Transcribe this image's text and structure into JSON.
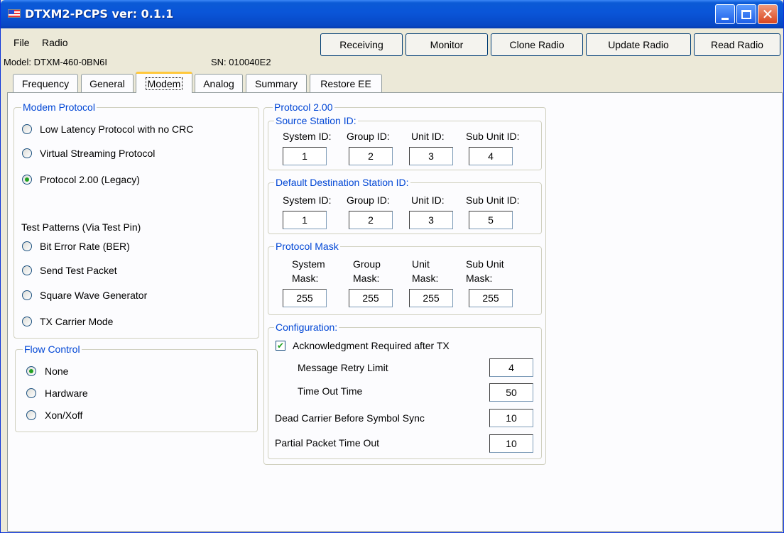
{
  "window": {
    "title": "DTXM2-PCPS ver: 0.1.1",
    "controls": {
      "minimize_icon": "minimize-icon",
      "maximize_icon": "maximize-icon",
      "close_icon": "close-icon"
    },
    "close_glyph": "✕"
  },
  "menu": {
    "file": "File",
    "radio": "Radio"
  },
  "toolbar": {
    "receiving": "Receiving",
    "monitor": "Monitor",
    "clone_radio": "Clone Radio",
    "update_radio": "Update Radio",
    "read_radio": "Read Radio"
  },
  "device": {
    "model": "Model: DTXM-460-0BN6I",
    "sn": "SN: 010040E2"
  },
  "tabs": [
    "Frequency",
    "General",
    "Modem",
    "Analog",
    "Summary",
    "Restore EE"
  ],
  "active_tab": "Modem",
  "modem_protocol": {
    "legend": "Modem Protocol",
    "options": [
      "Low Latency Protocol with no CRC",
      "Virtual Streaming Protocol",
      "Protocol 2.00 (Legacy)"
    ],
    "selected": "Protocol 2.00 (Legacy)",
    "test_patterns_label": "Test Patterns (Via Test Pin)",
    "test_patterns": [
      "Bit Error Rate (BER)",
      "Send Test Packet",
      "Square Wave Generator",
      "TX Carrier Mode"
    ]
  },
  "flow_control": {
    "legend": "Flow Control",
    "options": [
      "None",
      "Hardware",
      "Xon/Xoff"
    ],
    "selected": "None"
  },
  "protocol2": {
    "legend": "Protocol 2.00",
    "source_station": {
      "legend": "Source Station ID:",
      "labels": [
        "System ID:",
        "Group ID:",
        "Unit ID:",
        "Sub Unit ID:"
      ],
      "values": [
        "1",
        "2",
        "3",
        "4"
      ]
    },
    "default_destination": {
      "legend": "Default Destination Station ID:",
      "labels": [
        "System ID:",
        "Group ID:",
        "Unit ID:",
        "Sub Unit ID:"
      ],
      "values": [
        "1",
        "2",
        "3",
        "5"
      ]
    },
    "protocol_mask": {
      "legend": "Protocol Mask",
      "labels_line1": [
        "System",
        "Group",
        "Unit",
        "Sub Unit"
      ],
      "labels_line2": [
        "Mask:",
        "Mask:",
        "Mask:",
        "Mask:"
      ],
      "values": [
        "255",
        "255",
        "255",
        "255"
      ]
    },
    "configuration": {
      "legend": "Configuration:",
      "ack_label": "Acknowledgment Required after TX",
      "ack_checked": true,
      "check_glyph": "✔",
      "message_retry_label": "Message Retry Limit",
      "message_retry_value": "4",
      "time_out_label": "Time Out Time",
      "time_out_value": "50",
      "dead_carrier_label": "Dead Carrier Before Symbol Sync",
      "dead_carrier_value": "10",
      "partial_packet_label": "Partial Packet Time Out",
      "partial_packet_value": "10"
    }
  }
}
